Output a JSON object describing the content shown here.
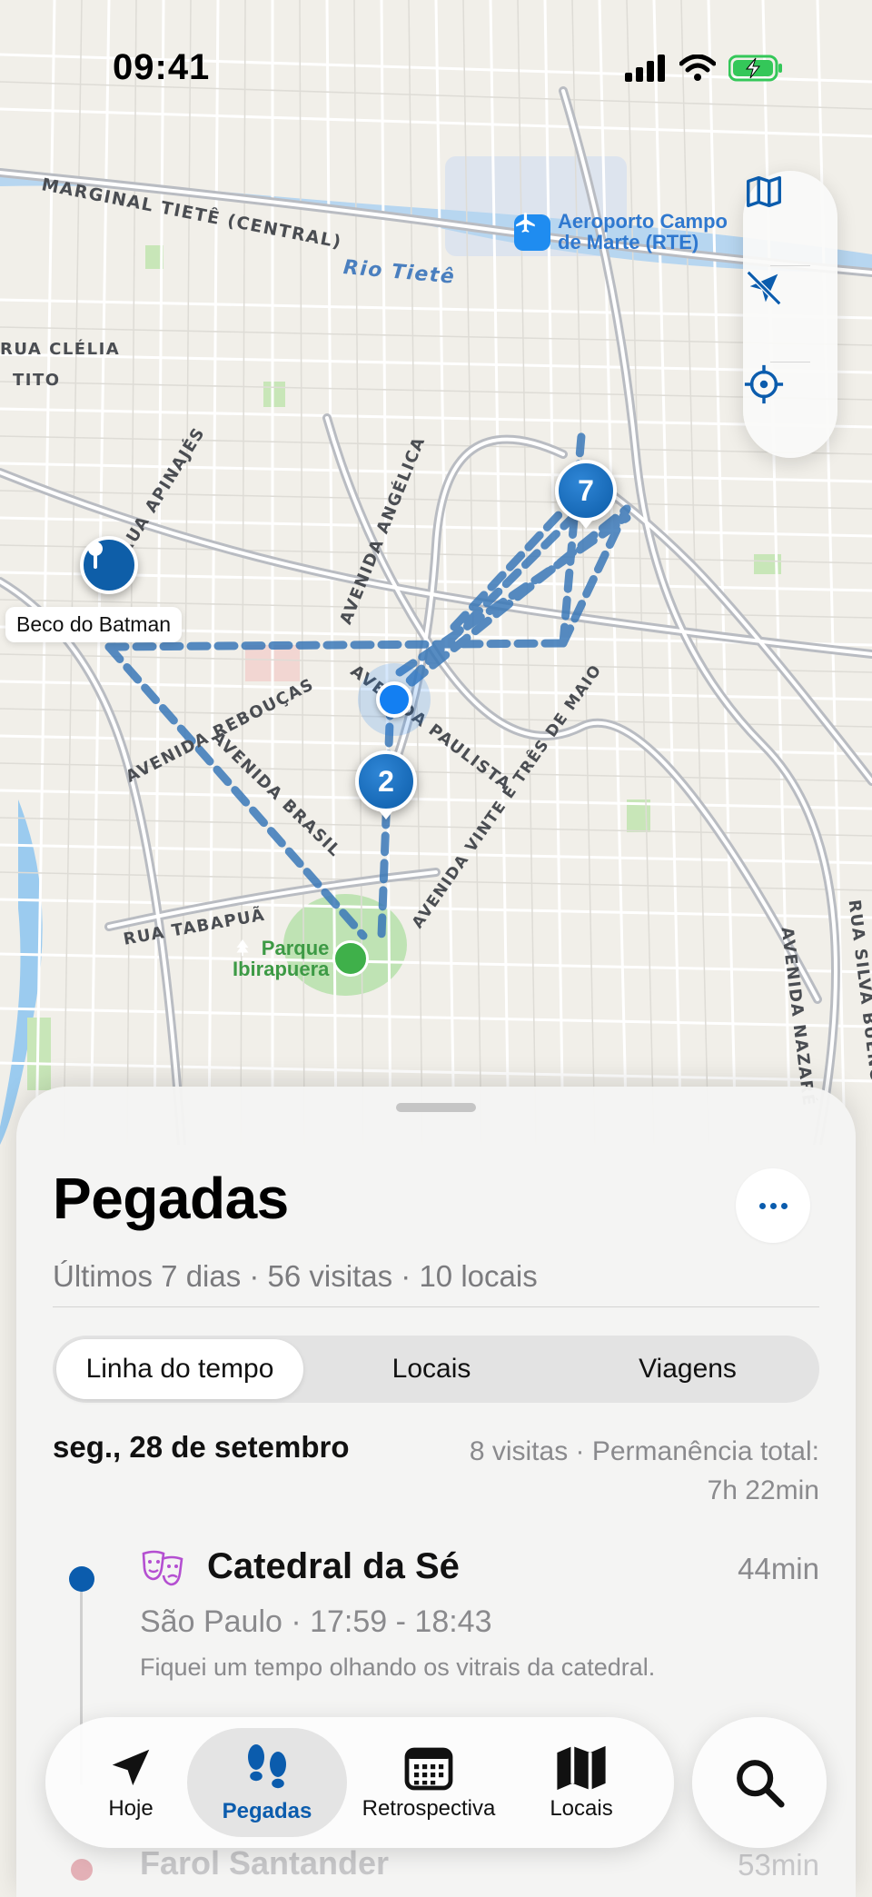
{
  "status_bar": {
    "time": "09:41"
  },
  "map": {
    "street_labels": [
      "MARGINAL TIETÊ (CENTRAL)",
      "Rio Tietê",
      "RUA CLÉLIA",
      "TITO",
      "RUA APINAJÉS",
      "AVENIDA ANGÉLICA",
      "AVENIDA REBOUÇAS",
      "AVENIDA BRASIL",
      "AVENIDA PAULISTA",
      "AVENIDA VINTE E TRÊS DE MAIO",
      "RUA TABAPUÃ",
      "AVENIDA NAZARÉ",
      "RUA SILVA BUENO"
    ],
    "airport_label_line1": "Aeroporto Campo",
    "airport_label_line2": "de Marte (RTE)",
    "park_label_line1": "Parque",
    "park_label_line2": "Ibirapuera",
    "poi_label": "Beco do Batman",
    "cluster_counts": [
      "7",
      "2"
    ],
    "controls": [
      "map-icon",
      "location-arrow-slash-icon",
      "crosshair-icon"
    ],
    "route_color": "#3a78b8",
    "pin_color": "#0e5ea8"
  },
  "sheet": {
    "title": "Pegadas",
    "subtitle": "Últimos 7 dias · 56 visitas · 10 locais",
    "segments": [
      "Linha do tempo",
      "Locais",
      "Viagens"
    ],
    "active_segment": "Linha do tempo",
    "day": {
      "label": "seg., 28 de setembro",
      "meta_line1": "8 visitas · Permanência total:",
      "meta_line2": "7h 22min"
    },
    "visits": [
      {
        "icon": "theater-masks-icon",
        "name": "Catedral da Sé",
        "duration": "44min",
        "subtitle": "São Paulo · 17:59 - 18:43",
        "note": "Fiquei um tempo olhando os vitrais da catedral."
      },
      {
        "name": "Farol Santander",
        "duration": "53min"
      }
    ]
  },
  "tabbar": {
    "tabs": [
      {
        "label": "Hoje",
        "icon": "location-arrow-icon"
      },
      {
        "label": "Pegadas",
        "icon": "footprints-icon"
      },
      {
        "label": "Retrospectiva",
        "icon": "calendar-icon"
      },
      {
        "label": "Locais",
        "icon": "map-icon"
      }
    ],
    "active_tab": "Pegadas",
    "search_icon": "magnifying-glass-icon"
  },
  "colors": {
    "accent": "#0b5cad",
    "active_tab_bg": "#e4e4e4"
  }
}
